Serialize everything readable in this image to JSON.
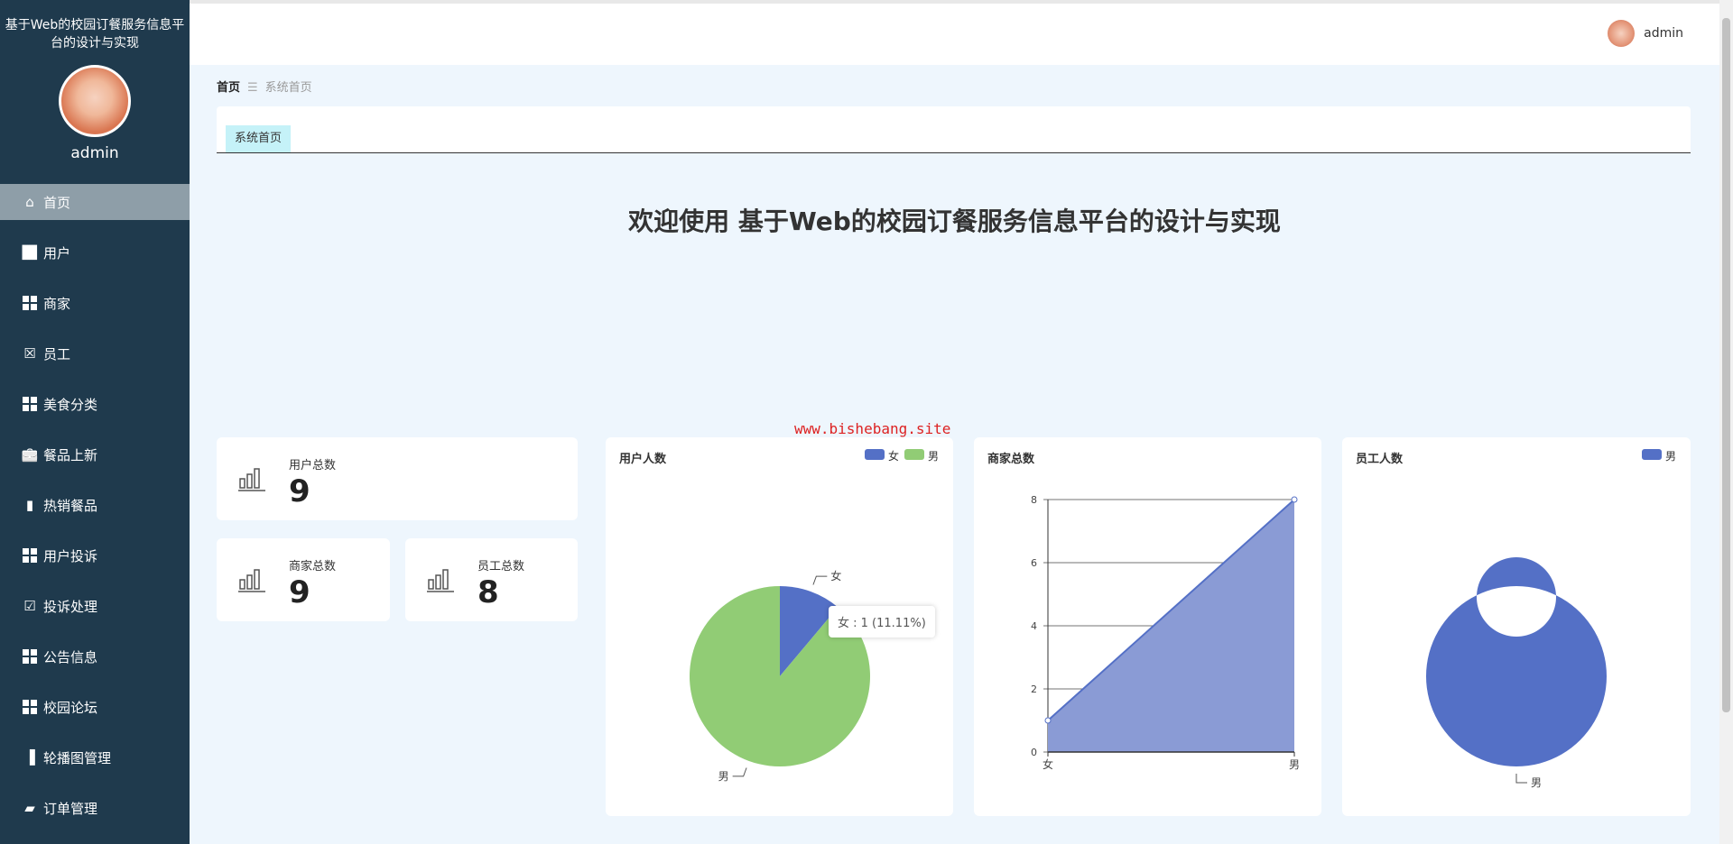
{
  "app": {
    "title": "基于Web的校园订餐服务信息平台的设计与实现",
    "user": "admin"
  },
  "sidebar": {
    "items": [
      {
        "label": "首页",
        "icon": "home-icon"
      },
      {
        "label": "用户",
        "icon": "chart-line-icon"
      },
      {
        "label": "商家",
        "icon": "grid-icon"
      },
      {
        "label": "员工",
        "icon": "clipboard-x-icon"
      },
      {
        "label": "美食分类",
        "icon": "grid-icon"
      },
      {
        "label": "餐品上新",
        "icon": "briefcase-icon"
      },
      {
        "label": "热销餐品",
        "icon": "bar-chart-icon"
      },
      {
        "label": "用户投诉",
        "icon": "grid-icon"
      },
      {
        "label": "投诉处理",
        "icon": "clipboard-check-icon"
      },
      {
        "label": "公告信息",
        "icon": "grid-icon"
      },
      {
        "label": "校园论坛",
        "icon": "grid-icon"
      },
      {
        "label": "轮播图管理",
        "icon": "book-icon"
      },
      {
        "label": "订单管理",
        "icon": "wallet-icon"
      }
    ]
  },
  "breadcrumb": {
    "home": "首页",
    "sep": "☰",
    "current": "系统首页"
  },
  "tabs": [
    {
      "label": "系统首页"
    }
  ],
  "welcome": "欢迎使用 基于Web的校园订餐服务信息平台的设计与实现",
  "watermark": "www.bishebang.site",
  "stats": [
    {
      "label": "用户总数",
      "value": "9"
    },
    {
      "label": "商家总数",
      "value": "9"
    },
    {
      "label": "员工总数",
      "value": "8"
    }
  ],
  "colors": {
    "blue": "#5470c6",
    "green": "#91cc75",
    "area": "#8a9bd5"
  },
  "chart_data": [
    {
      "type": "pie",
      "title": "用户人数",
      "legend": [
        "女",
        "男"
      ],
      "categories": [
        "女",
        "男"
      ],
      "values": [
        1,
        8
      ],
      "tooltip": "女 : 1 (11.11%)"
    },
    {
      "type": "area",
      "title": "商家总数",
      "categories": [
        "女",
        "男"
      ],
      "values": [
        1,
        8
      ],
      "ylim": [
        0,
        8
      ],
      "yticks": [
        "0",
        "2",
        "4",
        "6",
        "8"
      ]
    },
    {
      "type": "pie",
      "title": "员工人数",
      "legend": [
        "男"
      ],
      "categories": [
        "男"
      ],
      "values": [
        8
      ],
      "donut": true
    }
  ]
}
